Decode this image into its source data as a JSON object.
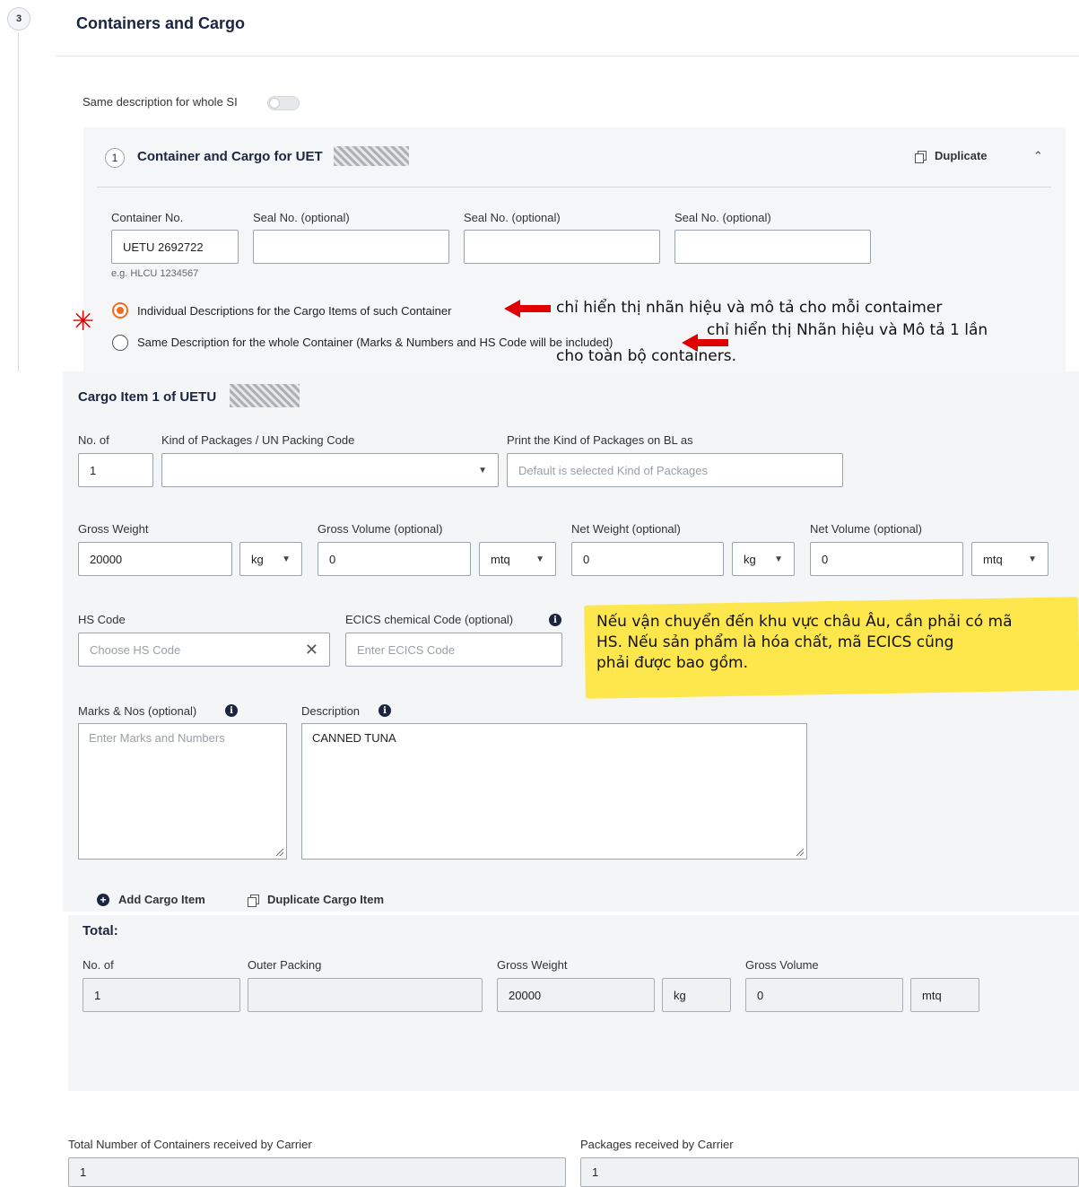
{
  "step": {
    "number": "3",
    "title": "Containers and Cargo"
  },
  "same_description_whole_si": {
    "label": "Same description for whole SI",
    "enabled": false
  },
  "container_card": {
    "index": "1",
    "title_prefix": "Container and Cargo for UET",
    "duplicate_label": "Duplicate",
    "container_no_label": "Container No.",
    "container_no_value": "UETU 2692722",
    "container_no_hint": "e.g. HLCU 1234567",
    "seal_labels": [
      "Seal No. (optional)",
      "Seal No. (optional)",
      "Seal No. (optional)"
    ],
    "options": [
      {
        "label": "Individual Descriptions for the Cargo Items of such Container",
        "selected": true
      },
      {
        "label": "Same Description for the whole Container (Marks & Numbers and HS Code will be included)",
        "selected": false
      }
    ]
  },
  "annotations": {
    "individual": "chỉ hiển thị nhãn hiệu và mô tả cho mỗi contaimer",
    "same_line1": "chỉ hiển thị Nhãn hiệu và Mô tả 1 lần",
    "same_line2": "cho toàn bộ containers.",
    "asterisk": "✳",
    "highlight": "Nếu vận chuyển đến khu vực châu Âu, cần phải có mã\nHS. Nếu sản phẩm là hóa chất, mã ECICS cũng\nphải được bao gồm.",
    "colors": {
      "arrow": "#e00000",
      "highlight": "#fde74c"
    }
  },
  "cargo_item": {
    "title": "Cargo Item 1 of UETU",
    "no_of_label": "No. of",
    "no_of_value": "1",
    "kind_label": "Kind of Packages / UN Packing Code",
    "print_kind_label": "Print the Kind of Packages on BL as",
    "print_kind_placeholder": "Default is selected Kind of Packages",
    "gross_weight_label": "Gross Weight",
    "gross_weight_value": "20000",
    "gross_weight_unit": "kg",
    "gross_volume_label": "Gross Volume (optional)",
    "gross_volume_value": "0",
    "gross_volume_unit": "mtq",
    "net_weight_label": "Net Weight (optional)",
    "net_weight_value": "0",
    "net_weight_unit": "kg",
    "net_volume_label": "Net Volume (optional)",
    "net_volume_value": "0",
    "net_volume_unit": "mtq",
    "hs_label": "HS Code",
    "hs_placeholder": "Choose HS Code",
    "ecics_label": "ECICS chemical Code (optional)",
    "ecics_placeholder": "Enter ECICS Code",
    "marks_label": "Marks & Nos (optional)",
    "marks_placeholder": "Enter Marks and Numbers",
    "description_label": "Description",
    "description_value": "CANNED TUNA",
    "add_label": "Add Cargo Item",
    "duplicate_label": "Duplicate Cargo Item"
  },
  "total": {
    "title": "Total:",
    "no_of_label": "No. of",
    "no_of_value": "1",
    "outer_label": "Outer Packing",
    "outer_value": "",
    "gross_weight_label": "Gross Weight",
    "gross_weight_value": "20000",
    "gross_weight_unit": "kg",
    "gross_volume_label": "Gross Volume",
    "gross_volume_value": "0",
    "gross_volume_unit": "mtq"
  },
  "carrier": {
    "containers_label": "Total Number of Containers received by Carrier",
    "containers_value": "1",
    "packages_label": "Packages received by Carrier",
    "packages_value": "1"
  }
}
